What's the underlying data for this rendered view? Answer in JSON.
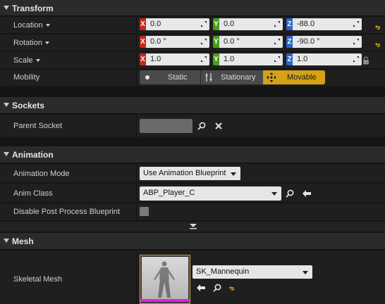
{
  "transform": {
    "title": "Transform",
    "location": {
      "label": "Location",
      "x": "0.0",
      "y": "0.0",
      "z": "-88.0"
    },
    "rotation": {
      "label": "Rotation",
      "x": "0.0 °",
      "y": "0.0 °",
      "z": "-90.0 °"
    },
    "scale": {
      "label": "Scale",
      "x": "1.0",
      "y": "1.0",
      "z": "1.0"
    },
    "axis_labels": {
      "x": "X",
      "y": "Y",
      "z": "Z"
    },
    "mobility": {
      "label": "Mobility",
      "options": [
        "Static",
        "Stationary",
        "Movable"
      ],
      "selected": "Movable"
    }
  },
  "sockets": {
    "title": "Sockets",
    "parent_socket_label": "Parent Socket"
  },
  "animation": {
    "title": "Animation",
    "mode_label": "Animation Mode",
    "mode_value": "Use Animation Blueprint",
    "anim_class_label": "Anim Class",
    "anim_class_value": "ABP_Player_C",
    "disable_pp_label": "Disable Post Process Blueprint",
    "disable_pp_checked": false
  },
  "mesh": {
    "title": "Mesh",
    "skeletal_mesh_label": "Skeletal Mesh",
    "skeletal_mesh_value": "SK_Mannequin"
  },
  "colors": {
    "accent": "#d4a117",
    "axis_x": "#c4281c",
    "axis_y": "#4b9c1b",
    "axis_z": "#2a66c8",
    "thumbnail_bar": "#e020d8"
  }
}
